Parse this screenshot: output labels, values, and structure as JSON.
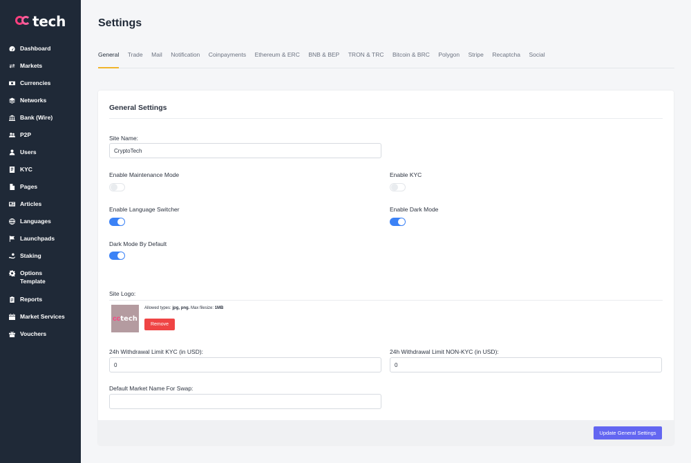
{
  "brand": {
    "logo_text": "tech",
    "accent": "#ff3f7f"
  },
  "sidebar": {
    "items": [
      {
        "label": "Dashboard",
        "icon": "dashboard-gauge-icon"
      },
      {
        "label": "Markets",
        "icon": "exchange-arrows-icon"
      },
      {
        "label": "Currencies",
        "icon": "money-bill-icon"
      },
      {
        "label": "Networks",
        "icon": "layers-icon"
      },
      {
        "label": "Bank (Wire)",
        "icon": "bank-icon"
      },
      {
        "label": "P2P",
        "icon": "users-icon"
      },
      {
        "label": "Users",
        "icon": "user-icon"
      },
      {
        "label": "KYC",
        "icon": "id-card-icon"
      },
      {
        "label": "Pages",
        "icon": "file-icon"
      },
      {
        "label": "Articles",
        "icon": "newspaper-icon"
      },
      {
        "label": "Languages",
        "icon": "globe-icon"
      },
      {
        "label": "Launchpads",
        "icon": "flag-icon"
      },
      {
        "label": "Staking",
        "icon": "hand-coin-icon"
      },
      {
        "label": "Options Template",
        "icon": "gear-icon"
      },
      {
        "label": "Reports",
        "icon": "clipboard-icon"
      },
      {
        "label": "Market Services",
        "icon": "calendar-icon"
      },
      {
        "label": "Vouchers",
        "icon": "gift-icon"
      }
    ]
  },
  "page": {
    "title": "Settings"
  },
  "tabs": [
    "General",
    "Trade",
    "Mail",
    "Notification",
    "Coinpayments",
    "Ethereum & ERC",
    "BNB & BEP",
    "TRON & TRC",
    "Bitcoin & BRC",
    "Polygon",
    "Stripe",
    "Recaptcha",
    "Social"
  ],
  "active_tab": "General",
  "form": {
    "title": "General Settings",
    "site_name_label": "Site Name:",
    "site_name_value": "CryptoTech",
    "maintenance_label": "Enable Maintenance Mode",
    "maintenance_on": false,
    "kyc_label": "Enable KYC",
    "kyc_on": false,
    "language_label": "Enable Language Switcher",
    "language_on": true,
    "dark_mode_label": "Enable Dark Mode",
    "dark_mode_on": true,
    "dark_default_label": "Dark Mode By Default",
    "dark_default_on": true,
    "site_logo_label": "Site Logo:",
    "logo_thumb_text": "tech",
    "allowed_prefix": "Allowed types: ",
    "allowed_types": "jpg, png.",
    "max_prefix": " Max filesize: ",
    "max_size": "1MB",
    "remove_label": "Remove",
    "limit_kyc_label": "24h Withdrawal Limit KYC (in USD):",
    "limit_kyc_value": "0",
    "limit_nonkyc_label": "24h Withdrawal Limit NON-KYC (in USD):",
    "limit_nonkyc_value": "0",
    "market_name_label": "Default Market Name For Swap:",
    "market_name_value": "",
    "update_label": "Update General Settings"
  }
}
